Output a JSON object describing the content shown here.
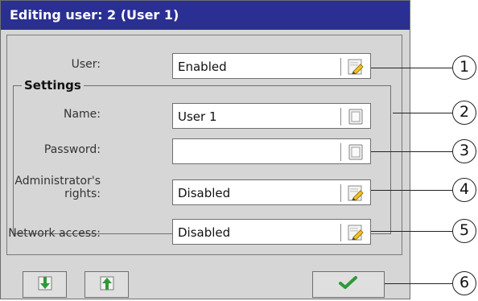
{
  "window": {
    "title": "Editing user: 2 (User 1)"
  },
  "fields": {
    "user": {
      "label": "User:",
      "value": "Enabled",
      "icon": "edit-icon"
    },
    "settings_title": "Settings",
    "name": {
      "label": "Name:",
      "value": "User 1",
      "icon": "keyboard-icon"
    },
    "password": {
      "label": "Password:",
      "value": "",
      "icon": "keyboard-icon"
    },
    "admin_rights": {
      "label": "Administrator's\nrights:",
      "value": "Disabled",
      "icon": "edit-icon"
    },
    "network_access": {
      "label": "Network access:",
      "value": "Disabled",
      "icon": "edit-icon"
    }
  },
  "buttons": {
    "down": {
      "icon": "arrow-down-icon"
    },
    "up": {
      "icon": "arrow-up-icon"
    },
    "confirm": {
      "icon": "checkmark-icon"
    }
  },
  "callouts": [
    "1",
    "2",
    "3",
    "4",
    "5",
    "6"
  ],
  "colors": {
    "titlebar": "#2a2f8f",
    "panel": "#d6d6d6",
    "field": "#ffffff",
    "accent_green": "#2f9a38",
    "accent_yellow": "#f3c32b"
  }
}
